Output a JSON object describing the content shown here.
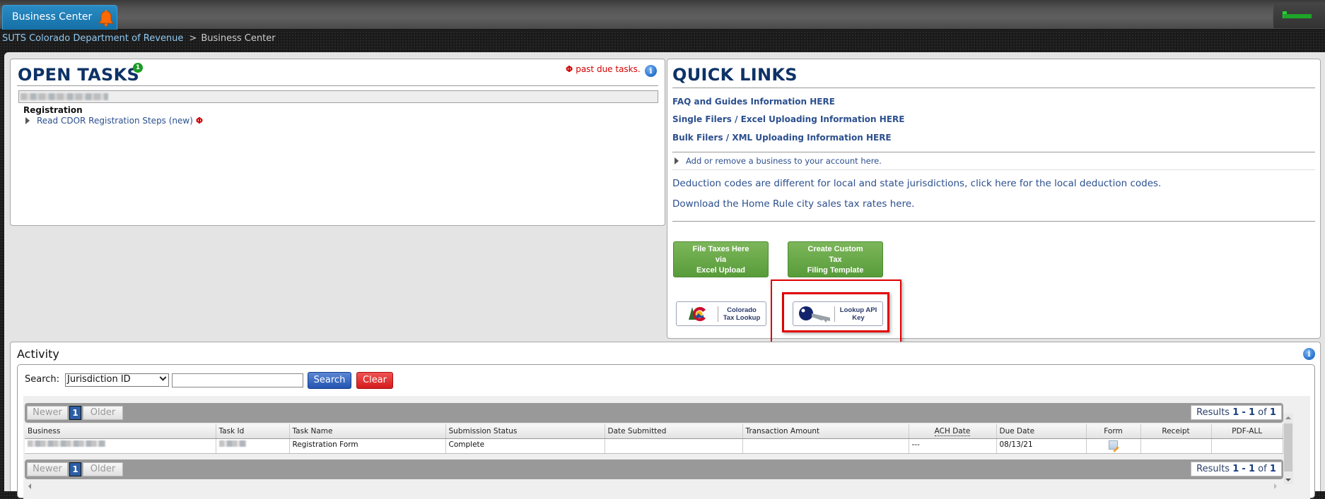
{
  "topbar": {
    "tab_label": "Business Center",
    "bell_icon": "bell-icon",
    "bell_color": "#ff6a00",
    "status_indicator_color": "#1ea52a"
  },
  "breadcrumb": {
    "root": "SUTS Colorado Department of Revenue",
    "separator": ">",
    "current": "Business Center"
  },
  "open_tasks": {
    "title": "OPEN TASKS",
    "count_badge": "1",
    "past_due_symbol": "Φ",
    "past_due_text": "past due tasks.",
    "info_icon": "info-icon",
    "business_name_blurred": "",
    "section": "Registration",
    "tasks": [
      {
        "label": "Read CDOR Registration Steps (new)",
        "past_due_marker": "Φ"
      }
    ]
  },
  "quick_links": {
    "title": "QUICK LINKS",
    "links": [
      "FAQ and Guides Information HERE",
      "Single Filers / Excel Uploading Information HERE",
      "Bulk Filers / XML Uploading Information HERE"
    ],
    "add_business": "Add or remove a business to your account here.",
    "deduction_codes": "Deduction codes are different for local and state jurisdictions, click here for the local deduction codes.",
    "home_rule": "Download the Home Rule city sales tax rates here.",
    "buttons": {
      "file_taxes": [
        "File Taxes Here",
        "via",
        "Excel Upload"
      ],
      "custom_template": [
        "Create Custom",
        "Tax",
        "Filing Template"
      ]
    },
    "logo_buttons": {
      "tax_lookup": [
        "Colorado",
        "Tax Lookup"
      ],
      "api_key": [
        "Lookup API",
        "Key"
      ]
    },
    "highlight_color": "#e00000"
  },
  "activity": {
    "title": "Activity",
    "search_label": "Search:",
    "search_field_selected": "Jurisdiction ID",
    "search_input_value": "",
    "search_button": "Search",
    "clear_button": "Clear",
    "pager": {
      "newer": "Newer",
      "page": "1",
      "older": "Older",
      "results_prefix": "Results",
      "results_from": "1",
      "results_sep": "-",
      "results_to": "1",
      "results_of": "of",
      "results_total": "1"
    },
    "columns": [
      "Business",
      "Task Id",
      "Task Name",
      "Submission Status",
      "Date Submitted",
      "Transaction Amount",
      "ACH Date",
      "Due Date",
      "Form",
      "Receipt",
      "PDF-ALL"
    ],
    "rows": [
      {
        "business": "",
        "task_id": "",
        "task_name": "Registration Form",
        "submission_status": "Complete",
        "date_submitted": "",
        "transaction_amount": "",
        "ach_date": "---",
        "due_date": "08/13/21",
        "form": "form-edit-icon",
        "receipt": "",
        "pdf_all": ""
      }
    ]
  }
}
